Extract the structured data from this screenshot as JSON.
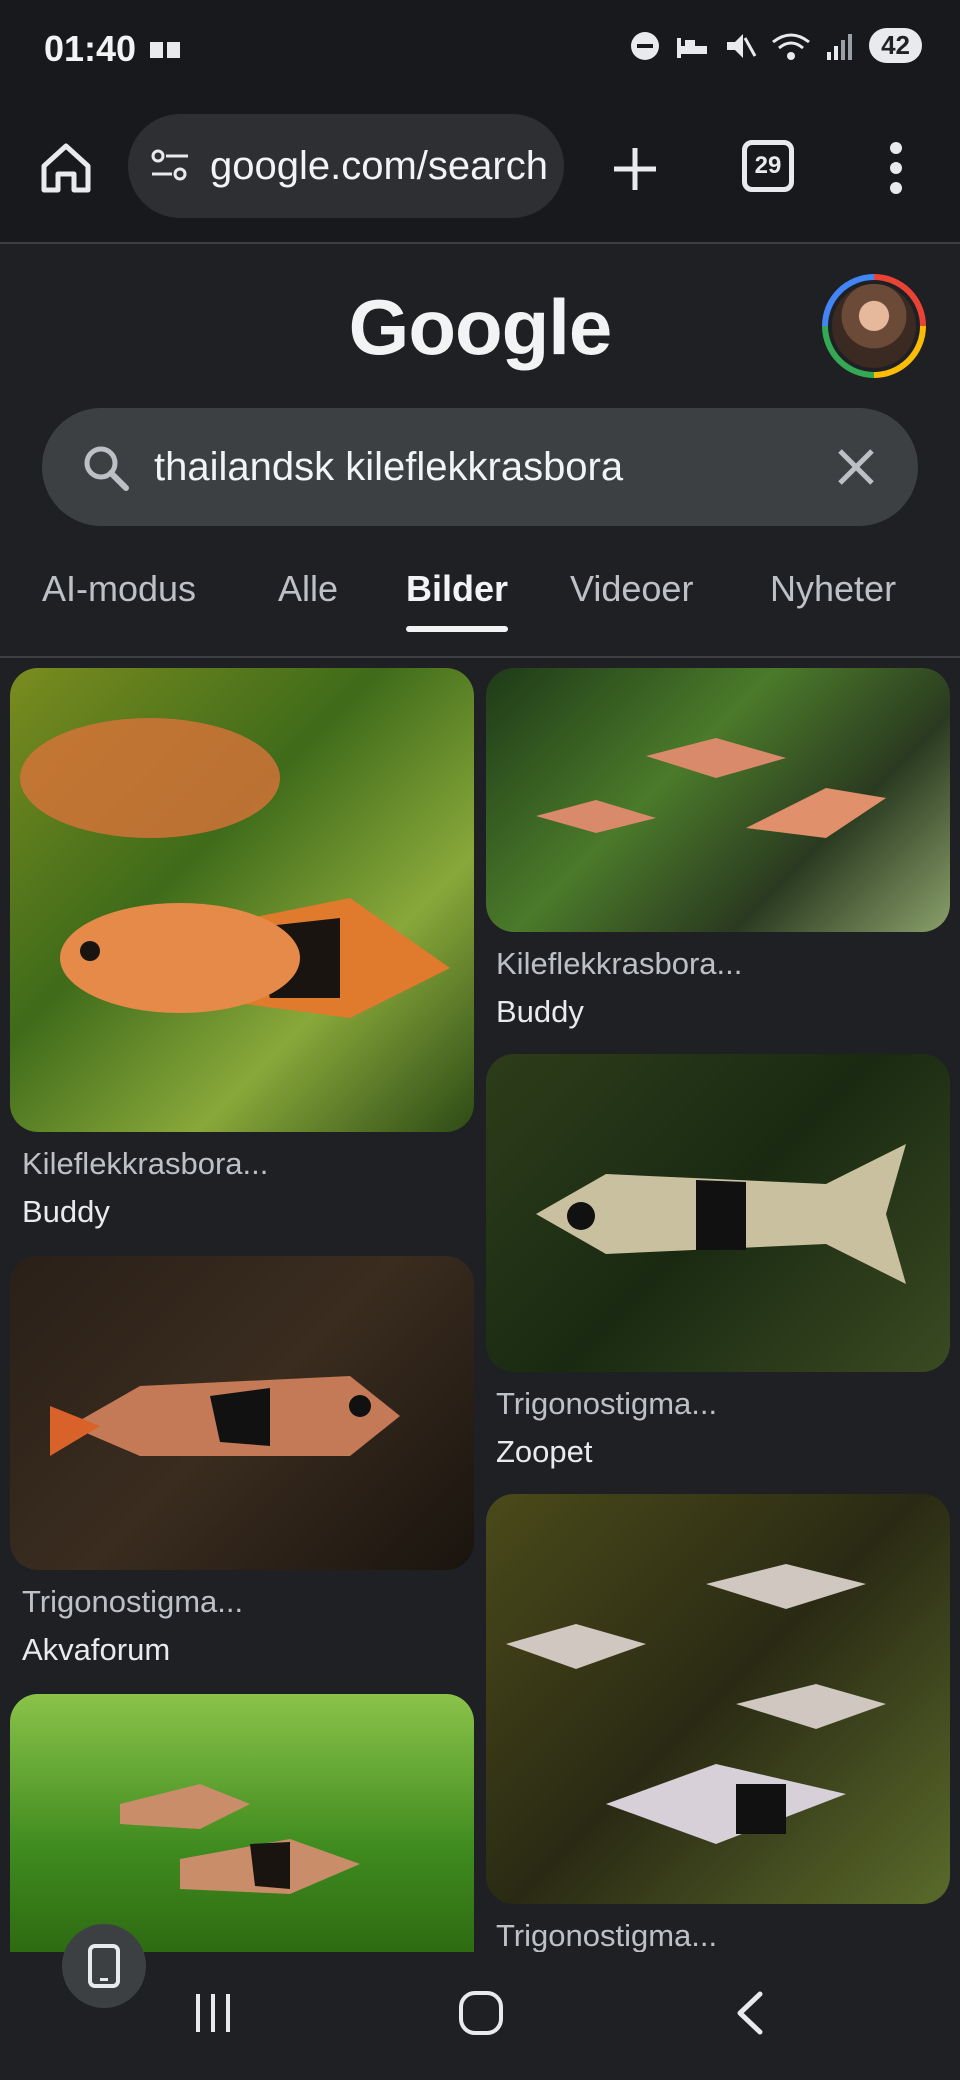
{
  "status": {
    "time": "01:40",
    "battery": "42"
  },
  "browser": {
    "url": "google.com/search",
    "tab_count": "29"
  },
  "google": {
    "logo": "Google"
  },
  "search": {
    "query": "thailandsk kileflekkrasbora"
  },
  "tabs": [
    {
      "label": "AI-modus"
    },
    {
      "label": "Alle"
    },
    {
      "label": "Bilder"
    },
    {
      "label": "Videoer"
    },
    {
      "label": "Nyheter"
    }
  ],
  "results": [
    {
      "title": "Kileflekkrasbora...",
      "source": "Buddy"
    },
    {
      "title": "Kileflekkrasbora...",
      "source": "Buddy"
    },
    {
      "title": "Trigonostigma...",
      "source": "Zoopet"
    },
    {
      "title": "Trigonostigma...",
      "source": "Akvaforum"
    },
    {
      "title": "Trigonostigma...",
      "source": ""
    },
    {
      "title": "",
      "source": ""
    }
  ],
  "colors": {
    "background": "#1f2024",
    "search_box": "#3c4043",
    "accent_text": "#f1f3f4"
  }
}
